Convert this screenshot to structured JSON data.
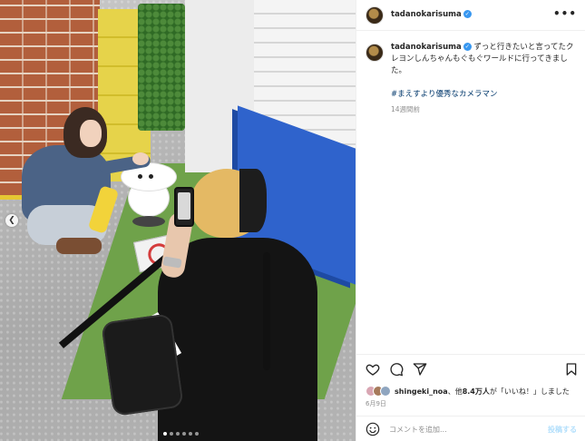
{
  "post": {
    "username": "tadanokarisuma",
    "caption": "ずっと行きたいと言ってたクレヨンしんちゃんもぐもぐワールドに行ってきました。",
    "hashtag": "#まえすより優秀なカメラマン",
    "time_ago": "14週間前"
  },
  "engagement": {
    "liker": "shingeki_noa",
    "likes_text_mid": "、他",
    "likes_count": "8.4万人",
    "likes_text_end": "が「いいね！」しました",
    "date": "6月9日"
  },
  "comment": {
    "placeholder": "コメントを追加...",
    "post_label": "投稿する"
  },
  "icons": {
    "more": "more-options-icon",
    "like": "heart-icon",
    "comment": "comment-icon",
    "share": "share-icon",
    "save": "bookmark-icon",
    "emoji": "emoji-icon",
    "carousel_prev": "chevron-left-icon"
  },
  "colors": {
    "verified": "#3897f0",
    "hashtag": "#00376b",
    "muted": "#8e8e8e",
    "post_button": "#b2dffc"
  },
  "carousel": {
    "total_slides": 6,
    "active_index": 0
  }
}
